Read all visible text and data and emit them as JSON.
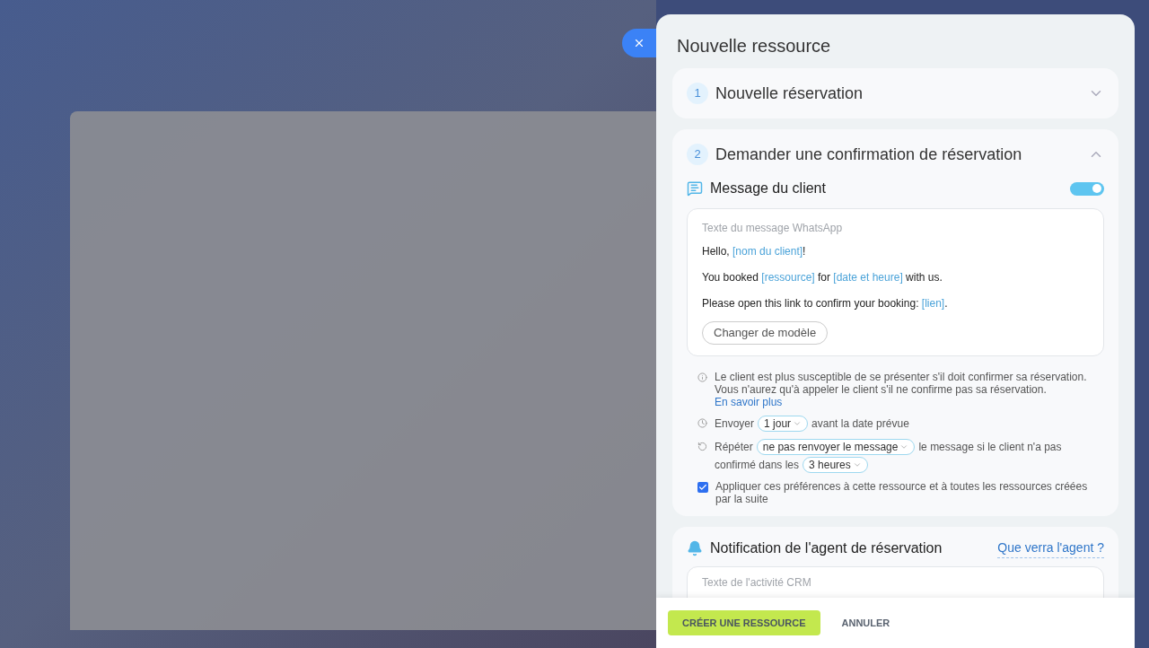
{
  "panel": {
    "title": "Nouvelle ressource"
  },
  "steps": [
    {
      "number": "1",
      "title": "Nouvelle réservation",
      "expanded": false
    },
    {
      "number": "2",
      "title": "Demander une confirmation de réservation",
      "expanded": true
    }
  ],
  "client_message": {
    "title": "Message du client",
    "on": true,
    "template_label": "Texte du message WhatsApp",
    "lines": [
      [
        {
          "kind": "text",
          "text": "Hello, "
        },
        {
          "kind": "variable",
          "text": "[nom du client]"
        },
        {
          "kind": "text",
          "text": "!"
        }
      ],
      [
        {
          "kind": "text",
          "text": "You booked "
        },
        {
          "kind": "variable",
          "text": "[ressource]"
        },
        {
          "kind": "text",
          "text": " for "
        },
        {
          "kind": "variable",
          "text": "[date et heure]"
        },
        {
          "kind": "text",
          "text": " with us."
        }
      ],
      [
        {
          "kind": "text",
          "text": "Please open this link to confirm your booking: "
        },
        {
          "kind": "variable",
          "text": "[lien]"
        },
        {
          "kind": "text",
          "text": "."
        }
      ]
    ],
    "change_button": "Changer de modèle"
  },
  "info": {
    "text": "Le client est plus susceptible de se présenter s'il doit confirmer sa réservation. Vous n'aurez qu'à appeler le client s'il ne confirme pas sa réservation.",
    "link": "En savoir plus"
  },
  "settings": [
    {
      "kind": "clock",
      "parts": [
        {
          "kind": "text",
          "text": "Envoyer"
        },
        {
          "kind": "select",
          "text": "1 jour"
        },
        {
          "kind": "text",
          "text": "avant la date prévue"
        }
      ]
    },
    {
      "kind": "repeat",
      "parts": [
        {
          "kind": "text",
          "text": "Répéter"
        },
        {
          "kind": "select",
          "text": "ne pas renvoyer le message"
        },
        {
          "kind": "text",
          "text": "le message si le client n'a pas"
        },
        {
          "kind": "text",
          "text": "confirmé dans les"
        },
        {
          "kind": "select",
          "text": "3 heures"
        }
      ]
    }
  ],
  "apply": {
    "label": "Appliquer ces préférences à cette ressource et à toutes les ressources créées par la suite",
    "checked": true
  },
  "agent_notification": {
    "title": "Notification de l'agent de réservation",
    "link": "Que verra l'agent ?",
    "field_label": "Texte de l'activité CRM"
  },
  "footer": {
    "primary": "CRÉER UNE RESSOURCE",
    "secondary": "ANNULER"
  }
}
